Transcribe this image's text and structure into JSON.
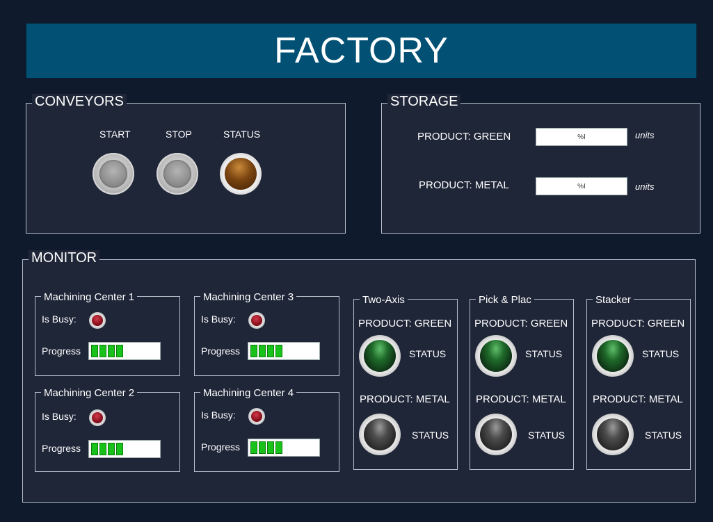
{
  "title": "FACTORY",
  "conveyors": {
    "label": "CONVEYORS",
    "start_label": "START",
    "stop_label": "STOP",
    "status_label": "STATUS"
  },
  "storage": {
    "label": "STORAGE",
    "rows": [
      {
        "product": "PRODUCT: GREEN",
        "value": "%I",
        "units": "units"
      },
      {
        "product": "PRODUCT: METAL",
        "value": "%I",
        "units": "units"
      }
    ]
  },
  "monitor": {
    "label": "MONITOR",
    "machining_centers": [
      {
        "name": "Machining Center 1",
        "busy_label": "Is Busy:",
        "progress_label": "Progress",
        "progress_segments": 4
      },
      {
        "name": "Machining Center 3",
        "busy_label": "Is Busy:",
        "progress_label": "Progress",
        "progress_segments": 4
      },
      {
        "name": "Machining Center 2",
        "busy_label": "Is Busy:",
        "progress_label": "Progress",
        "progress_segments": 4
      },
      {
        "name": "Machining Center 4",
        "busy_label": "Is Busy:",
        "progress_label": "Progress",
        "progress_segments": 4
      }
    ],
    "stations": [
      {
        "name": "Two-Axis",
        "green_label": "PRODUCT: GREEN",
        "metal_label": "PRODUCT: METAL",
        "status_label": "STATUS"
      },
      {
        "name": "Pick & Plac",
        "green_label": "PRODUCT: GREEN",
        "metal_label": "PRODUCT: METAL",
        "status_label": "STATUS"
      },
      {
        "name": "Stacker",
        "green_label": "PRODUCT: GREEN",
        "metal_label": "PRODUCT: METAL",
        "status_label": "STATUS"
      }
    ]
  },
  "colors": {
    "background": "#0f1a2c",
    "panel": "#1f2638",
    "title_bar": "#025174",
    "progress_fill": "#19c21b",
    "busy_led": "#8a0f1c",
    "status_lamp": "#7a4410"
  }
}
